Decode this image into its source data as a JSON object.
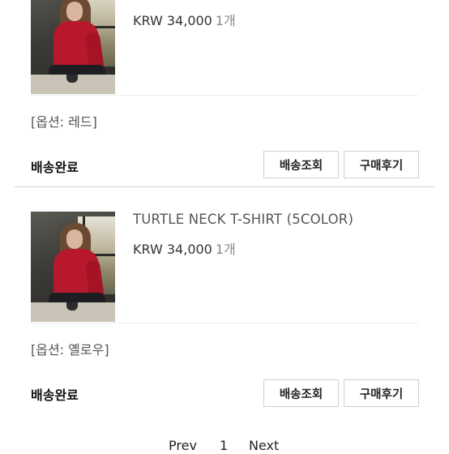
{
  "orders": [
    {
      "title": "",
      "price": "KRW 34,000",
      "quantity": "1개",
      "option": "[옵션: 레드]",
      "status": "배송완료",
      "track_button": "배송조회",
      "review_button": "구매후기"
    },
    {
      "title": "TURTLE NECK T-SHIRT (5COLOR)",
      "price": "KRW 34,000",
      "quantity": "1개",
      "option": "[옵션: 옐로우]",
      "status": "배송완료",
      "track_button": "배송조회",
      "review_button": "구매후기"
    }
  ],
  "pagination": {
    "prev_label": "Prev",
    "page_number": "1",
    "next_label": "Next"
  }
}
